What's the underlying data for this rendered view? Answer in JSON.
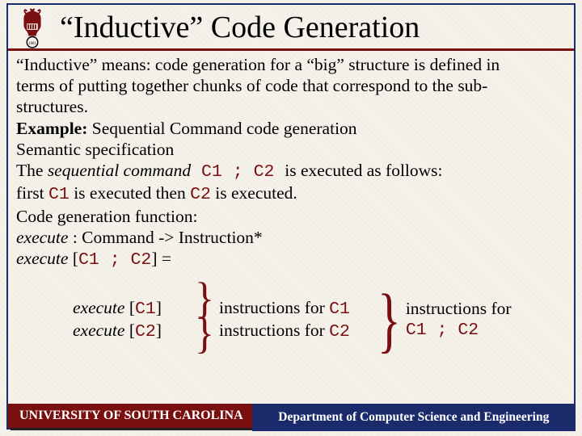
{
  "title": "“Inductive” Code Generation",
  "para1_a": "“Inductive” means: code generation for a “big” structure is defined in",
  "para1_b": "terms of putting together chunks of code that correspond to the sub-",
  "para1_c": "structures.",
  "example_label": "Example:",
  "example_rest": " Sequential Command code generation",
  "semspec": "Semantic specification",
  "spec_a_pre": "The ",
  "spec_a_em": "sequential command",
  "spec_a_code": " C1 ; C2 ",
  "spec_a_post": " is executed as follows:",
  "spec_b_pre": "first ",
  "spec_b_c1": "C1",
  "spec_b_mid": " is executed then ",
  "spec_b_c2": "C2",
  "spec_b_post": " is executed.",
  "cgf": "Code generation function:",
  "fn_sig_em1": "execute",
  "fn_sig_rest": " : Command -> Instruction*",
  "fn_def_em": "execute",
  "fn_def_code": "C1 ; C2",
  "fn_def_eq": " =",
  "row1_em": "execute",
  "row1_code": "C1",
  "row1_rhs_pre": "instructions for ",
  "row1_rhs_code": "C1",
  "row2_em": "execute",
  "row2_code": "C2",
  "row2_rhs_pre": "instructions for ",
  "row2_rhs_code": "C2",
  "combined_line1": "instructions for",
  "combined_code": "C1 ; C2",
  "footer_left": "UNIVERSITY OF SOUTH CAROLINA",
  "footer_right": "Department of Computer Science and Engineering"
}
